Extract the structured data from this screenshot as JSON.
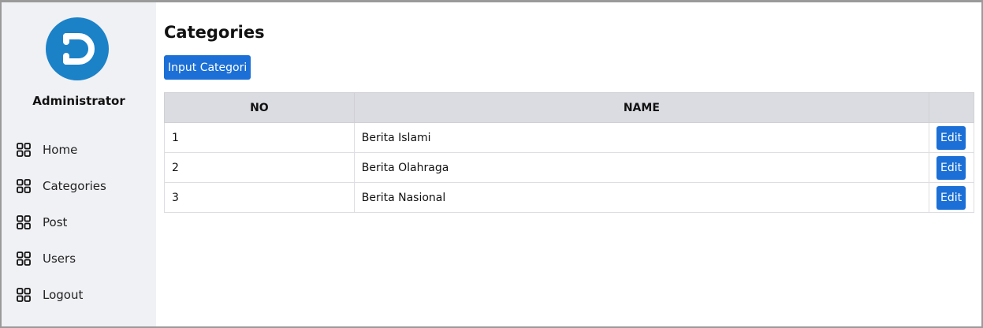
{
  "sidebar": {
    "profile": {
      "name": "Administrator",
      "logo_color": "#1b82c8"
    },
    "items": [
      {
        "label": "Home",
        "icon": "grid-icon"
      },
      {
        "label": "Categories",
        "icon": "grid-icon"
      },
      {
        "label": "Post",
        "icon": "grid-icon"
      },
      {
        "label": "Users",
        "icon": "grid-icon"
      },
      {
        "label": "Logout",
        "icon": "grid-icon"
      }
    ]
  },
  "main": {
    "title": "Categories",
    "add_button_label": "Input Categori",
    "table": {
      "headers": [
        "NO",
        "NAME",
        ""
      ],
      "rows": [
        {
          "no": "1",
          "name": "Berita Islami",
          "action": "Edit"
        },
        {
          "no": "2",
          "name": "Berita Olahraga",
          "action": "Edit"
        },
        {
          "no": "3",
          "name": "Berita Nasional",
          "action": "Edit"
        }
      ]
    }
  },
  "colors": {
    "accent": "#1b6fd6",
    "sidebar_bg": "#f0f1f5",
    "table_header_bg": "#dbdce1"
  }
}
